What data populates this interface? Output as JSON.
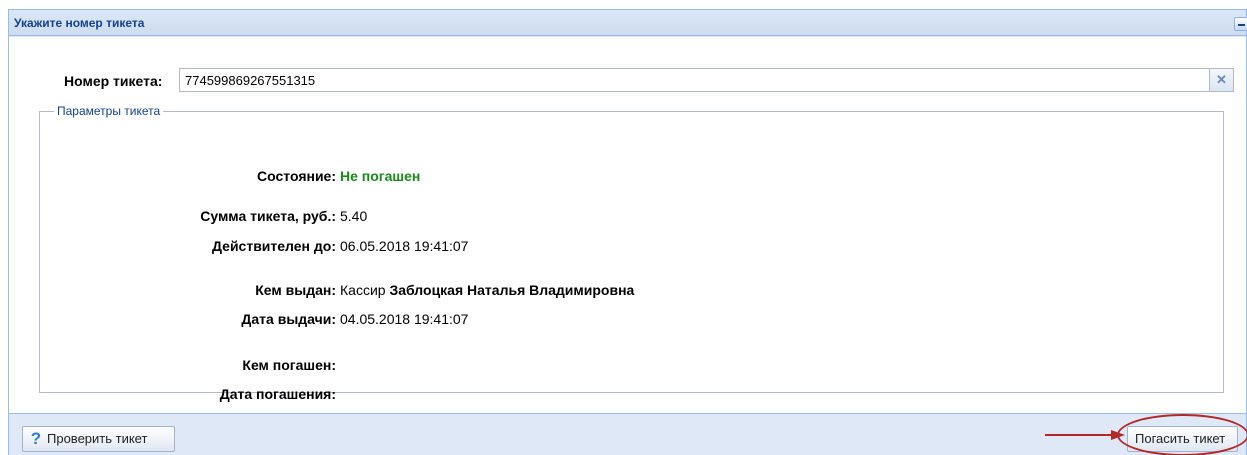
{
  "panel": {
    "title": "Укажите номер тикета"
  },
  "ticket": {
    "label": "Номер тикета:",
    "value": "774599869267551315",
    "clear_icon": "close-icon"
  },
  "params": {
    "legend": "Параметры тикета",
    "status_label": "Состояние:",
    "status_value": "Не погашен",
    "status_color": "#1a8a1a",
    "amount_label": "Сумма тикета, руб.:",
    "amount_value": "5.40",
    "valid_until_label": "Действителен до:",
    "valid_until_value": "06.05.2018 19:41:07",
    "issued_by_label": "Кем выдан:",
    "issued_by_role": "Кассир",
    "issued_by_name": "Заблоцкая Наталья Владимировна",
    "issue_date_label": "Дата выдачи:",
    "issue_date_value": "04.05.2018 19:41:07",
    "redeemed_by_label": "Кем погашен:",
    "redeemed_by_value": "",
    "redeem_date_label": "Дата погашения:",
    "redeem_date_value": ""
  },
  "footer": {
    "check_button_label": "Проверить тикет",
    "check_button_icon": "help-icon",
    "redeem_button_label": "Погасить тикет"
  },
  "annotation": {
    "color": "#b02828"
  }
}
